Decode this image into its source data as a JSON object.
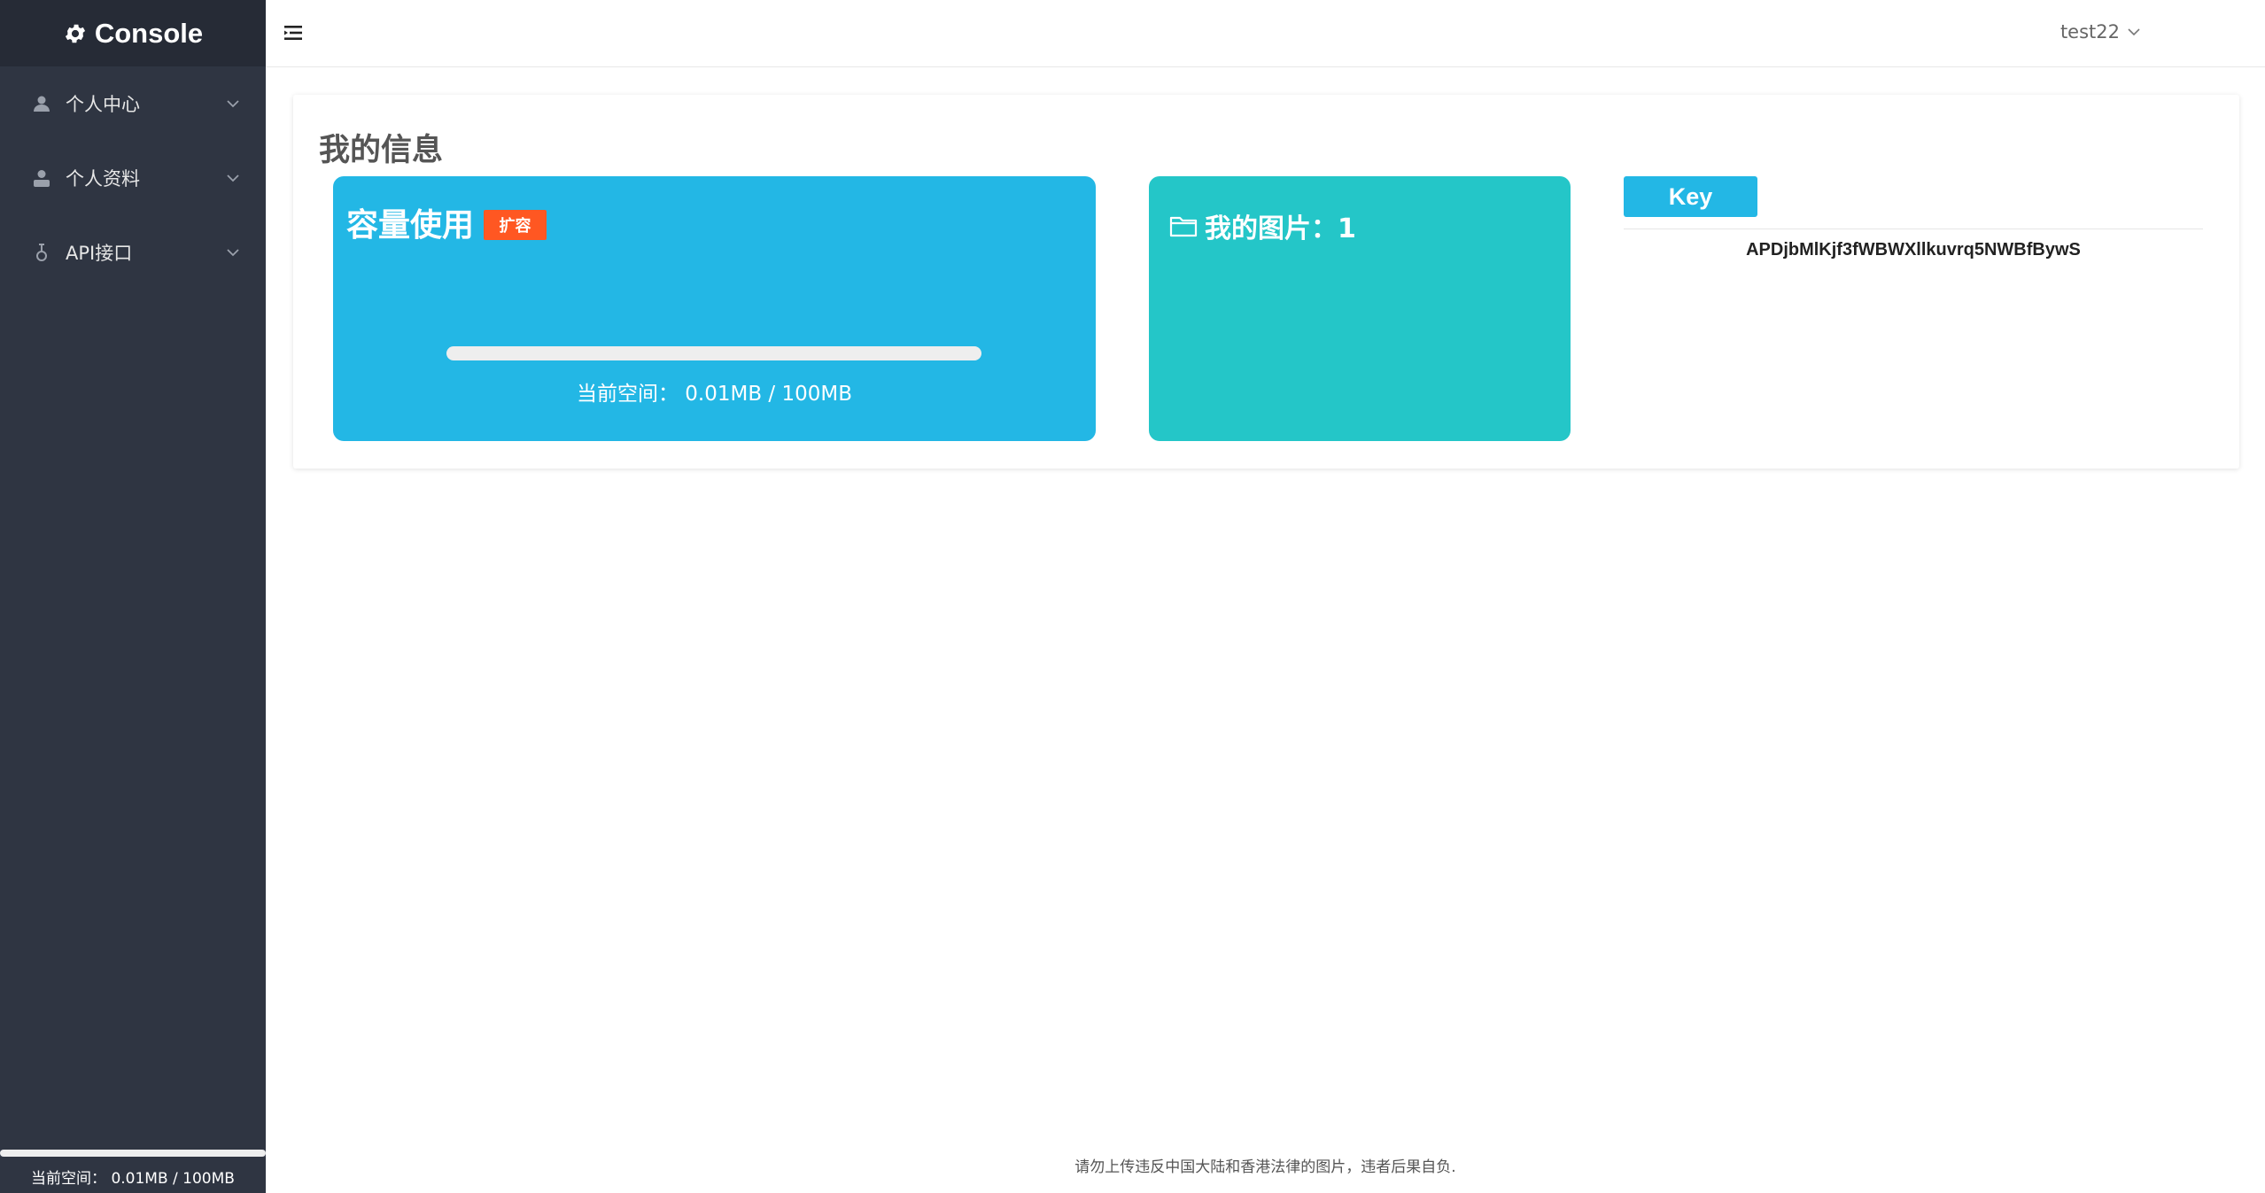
{
  "sidebar": {
    "title": "Console",
    "items": [
      {
        "label": "个人中心",
        "icon": "user-icon"
      },
      {
        "label": "个人资料",
        "icon": "profile-icon"
      },
      {
        "label": "API接口",
        "icon": "api-icon"
      }
    ],
    "storage_fraction": 0.0001,
    "storage_text": "当前空间： 0.01MB / 100MB"
  },
  "topbar": {
    "menu_icon": "menu-toggle-icon",
    "username": "test22"
  },
  "main": {
    "title": "我的信息",
    "storage_card": {
      "title": "容量使用",
      "badge": "扩容",
      "used_fraction": 0.0001,
      "text": "当前空间： 0.01MB / 100MB",
      "color": "#23b7e5"
    },
    "images_card": {
      "title": "我的图片：1",
      "icon": "folder-icon",
      "color": "#24c6c8"
    },
    "key": {
      "button_label": "Key",
      "value": "APDjbMlKjf3fWBWXllkuvrq5NWBfBywS"
    }
  },
  "footer": {
    "notice": "请勿上传违反中国大陆和香港法律的图片，违者后果自负."
  },
  "colors": {
    "sidebar_bg": "#2f3542",
    "accent_blue": "#23b7e5",
    "accent_teal": "#24c6c8",
    "badge_orange": "#ff5722"
  }
}
